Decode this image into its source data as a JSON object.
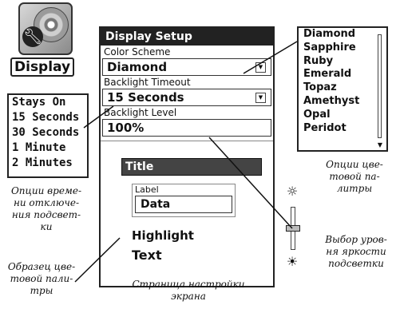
{
  "app": {
    "icon": "display-settings-icon",
    "label": "Display"
  },
  "timeout_options": [
    "Stays On",
    "15 Seconds",
    "30 Seconds",
    "1 Minute",
    "2 Minutes"
  ],
  "device": {
    "title": "Display Setup",
    "color_scheme_label": "Color Scheme",
    "color_scheme_value": "Diamond",
    "backlight_timeout_label": "Backlight Timeout",
    "backlight_timeout_value": "15 Seconds",
    "backlight_level_label": "Backlight Level",
    "backlight_level_value": "100%",
    "sample": {
      "title": "Title",
      "label": "Label",
      "data": "Data",
      "highlight": "Highlight",
      "text": "Text"
    }
  },
  "color_schemes": [
    "Diamond",
    "Sapphire",
    "Ruby",
    "Emerald",
    "Topaz",
    "Amethyst",
    "Opal",
    "Peridot"
  ],
  "brightness_slider": {
    "level": 0.5,
    "icon_top": "bright-lamp-icon",
    "icon_bottom": "dim-lamp-icon"
  },
  "captions": {
    "timeout": "Опции време-\nни отключе-\nния подсвет-\nки",
    "scheme": "Опции цве-\nтовой па-\nлитры",
    "brightness": "Выбор уров-\nня яркости\nподсветки",
    "sample": "Образец цве-\nтовой пали-\nтры",
    "screen": "Страница настройки\nэкрана"
  }
}
